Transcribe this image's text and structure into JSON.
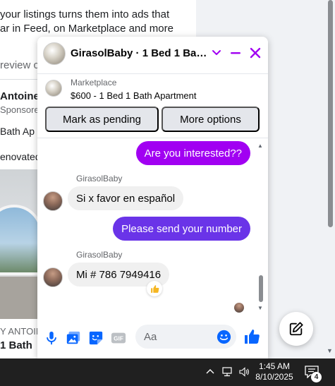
{
  "background_page": {
    "lines": [
      "your listings turns them into ads that",
      "ar in Feed, on Marketplace and more"
    ],
    "review_fragment": "review c",
    "advertiser_name": "Antoine",
    "sponsored": "Sponsored",
    "listing_title_fragment": "Bath Ap",
    "description_fragment": "enovated",
    "bottom_name_fragment": "Y ANTOIN",
    "bottom_title_fragment": "1 Bath"
  },
  "chat": {
    "title": "GirasolBaby · 1 Bed 1 Bath ...",
    "listing": {
      "source": "Marketplace",
      "title": "$600 - 1 Bed 1 Bath Apartment",
      "mark_pending_label": "Mark as pending",
      "more_options_label": "More options"
    },
    "messages": [
      {
        "direction": "outgoing",
        "text": "Are you interested??"
      },
      {
        "direction": "incoming",
        "sender": "GirasolBaby",
        "text": "Si x favor en español"
      },
      {
        "direction": "outgoing",
        "text": "Please send your number"
      },
      {
        "direction": "incoming",
        "sender": "GirasolBaby",
        "text": "Mi # 786 7949416",
        "reaction": "thumbs-up"
      }
    ],
    "composer": {
      "placeholder": "Aa",
      "icons": [
        "microphone-icon",
        "photo-icon",
        "sticker-icon",
        "gif-icon",
        "emoji-icon",
        "like-icon"
      ]
    },
    "colors": {
      "accent": "#a100f2",
      "outgoing_1": "#a100f2",
      "outgoing_2": "#6a34e8",
      "composer_icons": "#0866ff"
    }
  },
  "taskbar": {
    "time": "1:45 AM",
    "date": "8/10/2025",
    "notification_count": "4"
  }
}
